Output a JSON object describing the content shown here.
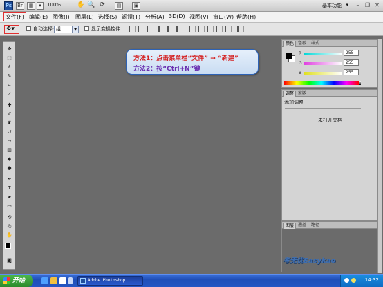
{
  "titlebar": {
    "zoom": "100%",
    "workspace": "基本功能",
    "window_buttons": [
      "minimize-icon",
      "restore-icon",
      "close-icon"
    ]
  },
  "menubar": {
    "items": [
      "文件(F)",
      "编辑(E)",
      "图像(I)",
      "图层(L)",
      "选择(S)",
      "滤镜(T)",
      "分析(A)",
      "3D(D)",
      "视图(V)",
      "窗口(W)",
      "帮助(H)"
    ]
  },
  "options": {
    "auto_select_label": "自动选择:",
    "auto_select_value": "组",
    "transform_label": "显示变换控件"
  },
  "callout": {
    "line1": "方法1：点击菜单栏“文件”  →  “新建”",
    "line2": "方法2：按“Ctrl+N”键",
    "accent_border": "#2d62b5"
  },
  "color_panel": {
    "tabs": [
      "颜色",
      "色板",
      "样式"
    ],
    "channels": [
      {
        "label": "R",
        "value": "255",
        "color": "#00d8d8"
      },
      {
        "label": "G",
        "value": "255",
        "color": "#e040e0"
      },
      {
        "label": "B",
        "value": "255",
        "color": "#e0e020"
      }
    ]
  },
  "adjust_panel": {
    "tabs": [
      "调整",
      "蒙版"
    ],
    "title": "添加调整",
    "message": "未打开文档"
  },
  "layers_panel": {
    "tabs": [
      "图层",
      "通道",
      "路径"
    ]
  },
  "watermark": "考无忧Easykao",
  "taskbar": {
    "start_label": "开始",
    "task_label": "Adobe Photoshop ...",
    "clock": "14:32"
  }
}
